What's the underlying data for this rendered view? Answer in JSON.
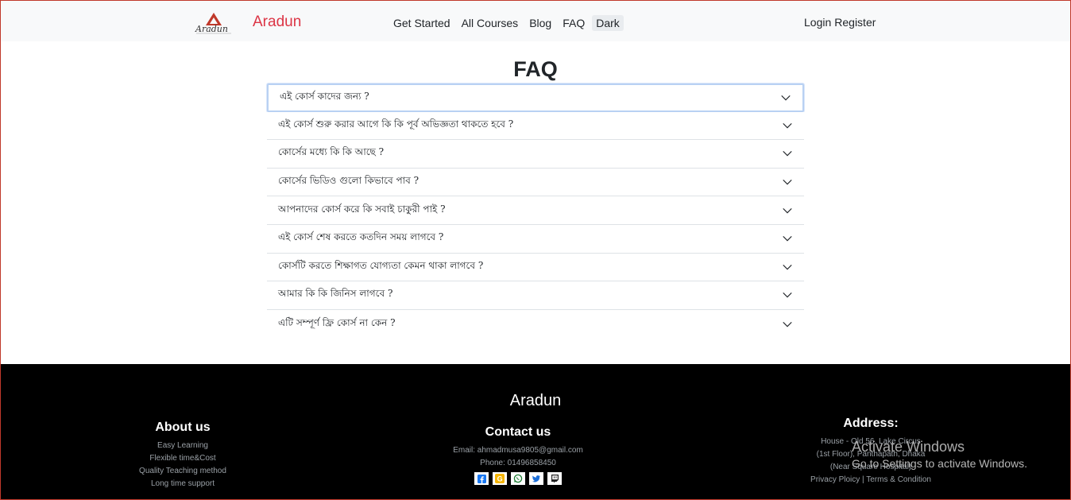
{
  "nav": {
    "brand": "Aradun",
    "logo_text": "Aradun",
    "links": [
      "Get Started",
      "All Courses",
      "Blog",
      "FAQ"
    ],
    "theme_toggle": "Dark",
    "login": "Login",
    "register": "Register"
  },
  "faq": {
    "title": "FAQ",
    "items": [
      "এই কোর্স কাদের জন্য ?",
      "এই কোর্স শুরু করার আগে কি কি পূর্ব অভিজ্ঞতা থাকতে হবে ?",
      "কোর্সের মধ্যে কি কি আছে ?",
      "কোর্সের ভিডিও গুলো কিভাবে পাব ?",
      "আপনাদের কোর্স করে কি সবাই চাকুরী পাই ?",
      "এই কোর্স শেষ করতে কতদিন সময় লাগবে ?",
      "কোর্সটি করতে শিক্ষাগত যোগ্যতা কেমন থাকা লাগবে ?",
      "আমার কি কি জিনিস লাগবে ?",
      "এটি সম্পূর্ণ ফ্রি কোর্স না কেন ?"
    ]
  },
  "footer": {
    "brand": "Aradun",
    "about": {
      "title": "About us",
      "items": [
        "Easy Learning",
        "Flexible time&Cost",
        "Quality Teaching method",
        "Long time support"
      ]
    },
    "contact": {
      "title": "Contact us",
      "email": "Email: ahmadmusa9805@gmail.com",
      "phone": "Phone: 01496858450",
      "social_icons": [
        "facebook-icon",
        "google-icon",
        "whatsapp-icon",
        "twitter-icon",
        "twitch-icon"
      ]
    },
    "address": {
      "title": "Address:",
      "line1": "House - Old 56, Lake Circus",
      "line2": "(1st Floor), Panthapath, Dhaka",
      "line3": "(Near Square Hospital)",
      "links": "Privacy Ploicy | Terms & Condition"
    }
  },
  "watermark": {
    "line1": "Activate Windows",
    "line2": "Go to Settings to activate Windows."
  },
  "colors": {
    "brand": "#dc3545",
    "navbar_bg": "#f8f9fa",
    "footer_bg": "#000000"
  }
}
